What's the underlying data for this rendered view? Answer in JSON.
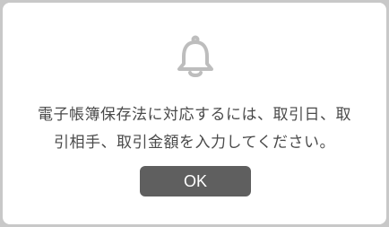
{
  "dialog": {
    "icon": "bell-icon",
    "message_line1": "電子帳簿保存法に対応するには、取引日、取",
    "message_line2": "引相手、取引金額を入力してください。",
    "ok_label": "OK"
  },
  "colors": {
    "text": "#4a4a4a",
    "button_bg": "#5f5f5f",
    "icon": "#bdbdbd"
  }
}
